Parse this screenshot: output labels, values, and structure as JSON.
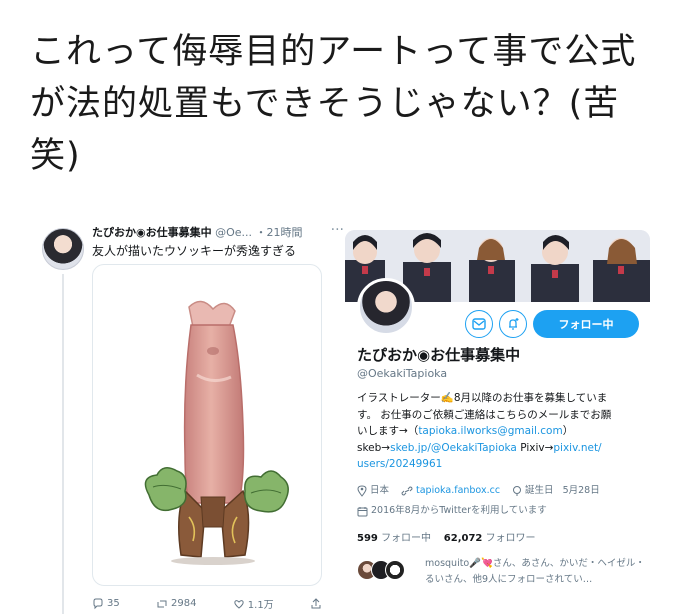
{
  "post": {
    "text": "これって侮辱目的アートって事で公式が法的処置もできそうじゃない？(苦笑)"
  },
  "tweet": {
    "name": "たぴおか◉お仕事募集中",
    "handle": "@Oe...",
    "time": "・21時間",
    "more": "···",
    "text": "友人が描いたウソッキーが秀逸すぎる",
    "actions": {
      "reply_count": "35",
      "retweet_count": "2984",
      "like_count": "1.1万"
    }
  },
  "profile": {
    "follow_button": "フォロー中",
    "name": "たぴおか◉お仕事募集中",
    "handle": "@OekakiTapioka",
    "bio_line1": "イラストレーター✍️8月以降のお仕事を募集していま",
    "bio_line2": "す。 お仕事のご依頼ご連絡はこちらのメールまでお願",
    "bio_line3_prefix": "いします→（",
    "bio_email": "tapioka.ilworks@gmail.com",
    "bio_line3_suffix": "）",
    "bio_skeb_prefix": "skeb→",
    "bio_skeb_link": "skeb.jp/@OekakiTapioka",
    "bio_pixiv_prefix": " Pixiv→",
    "bio_pixiv_link": "pixiv.net/",
    "bio_pixiv_link2": "users/20249961",
    "location": "日本",
    "website": "tapioka.fanbox.cc",
    "birthday_label": "誕生日",
    "birthday": "5月28日",
    "joined": "2016年8月からTwitterを利用しています",
    "following_count": "599",
    "following_label": "フォロー中",
    "followers_count": "62,072",
    "followers_label": "フォロワー",
    "followed_by": "mosquito🎤💘さん、あさん、かいだ・ヘイゼル・るいさん、他9人にフォローされてい…"
  },
  "colors": {
    "accent": "#1da1f2",
    "link": "#1b95e0",
    "muted": "#657786"
  }
}
